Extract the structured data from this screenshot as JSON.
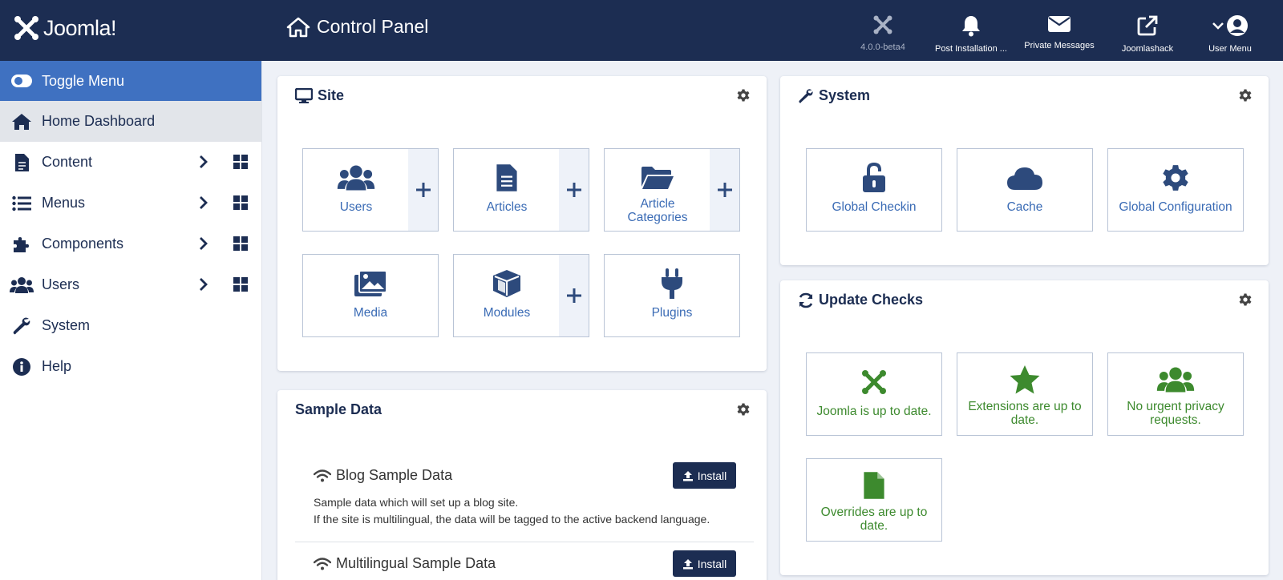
{
  "header": {
    "logo_text": "Joomla!",
    "title": "Control Panel",
    "items": [
      {
        "label": "4.0.0-beta4"
      },
      {
        "label": "Post Installation ..."
      },
      {
        "label": "Private Messages"
      },
      {
        "label": "Joomlashack"
      },
      {
        "label": "User Menu"
      }
    ]
  },
  "sidebar": {
    "items": [
      {
        "label": "Toggle Menu"
      },
      {
        "label": "Home Dashboard"
      },
      {
        "label": "Content"
      },
      {
        "label": "Menus"
      },
      {
        "label": "Components"
      },
      {
        "label": "Users"
      },
      {
        "label": "System"
      },
      {
        "label": "Help"
      }
    ]
  },
  "site": {
    "title": "Site",
    "tiles": [
      {
        "label": "Users"
      },
      {
        "label": "Articles"
      },
      {
        "label": "Article Categories"
      },
      {
        "label": "Media"
      },
      {
        "label": "Modules"
      },
      {
        "label": "Plugins"
      }
    ],
    "plus": "+"
  },
  "system": {
    "title": "System",
    "tiles": [
      {
        "label": "Global Checkin"
      },
      {
        "label": "Cache"
      },
      {
        "label": "Global Configuration"
      }
    ]
  },
  "updates": {
    "title": "Update Checks",
    "tiles": [
      {
        "label": "Joomla is up to date."
      },
      {
        "label": "Extensions are up to date."
      },
      {
        "label": "No urgent privacy requests."
      },
      {
        "label": "Overrides are up to date."
      }
    ]
  },
  "sample_data": {
    "title": "Sample Data",
    "install_label": "Install",
    "items": [
      {
        "name": "Blog Sample Data",
        "desc1": "Sample data which will set up a blog site.",
        "desc2": "If the site is multilingual, the data will be tagged to the active backend language."
      },
      {
        "name": "Multilingual Sample Data"
      }
    ]
  },
  "colors": {
    "header_bg": "#1c2d52",
    "accent": "#3f71c1",
    "link": "#3a6bb5",
    "success": "#3d8a2e"
  }
}
